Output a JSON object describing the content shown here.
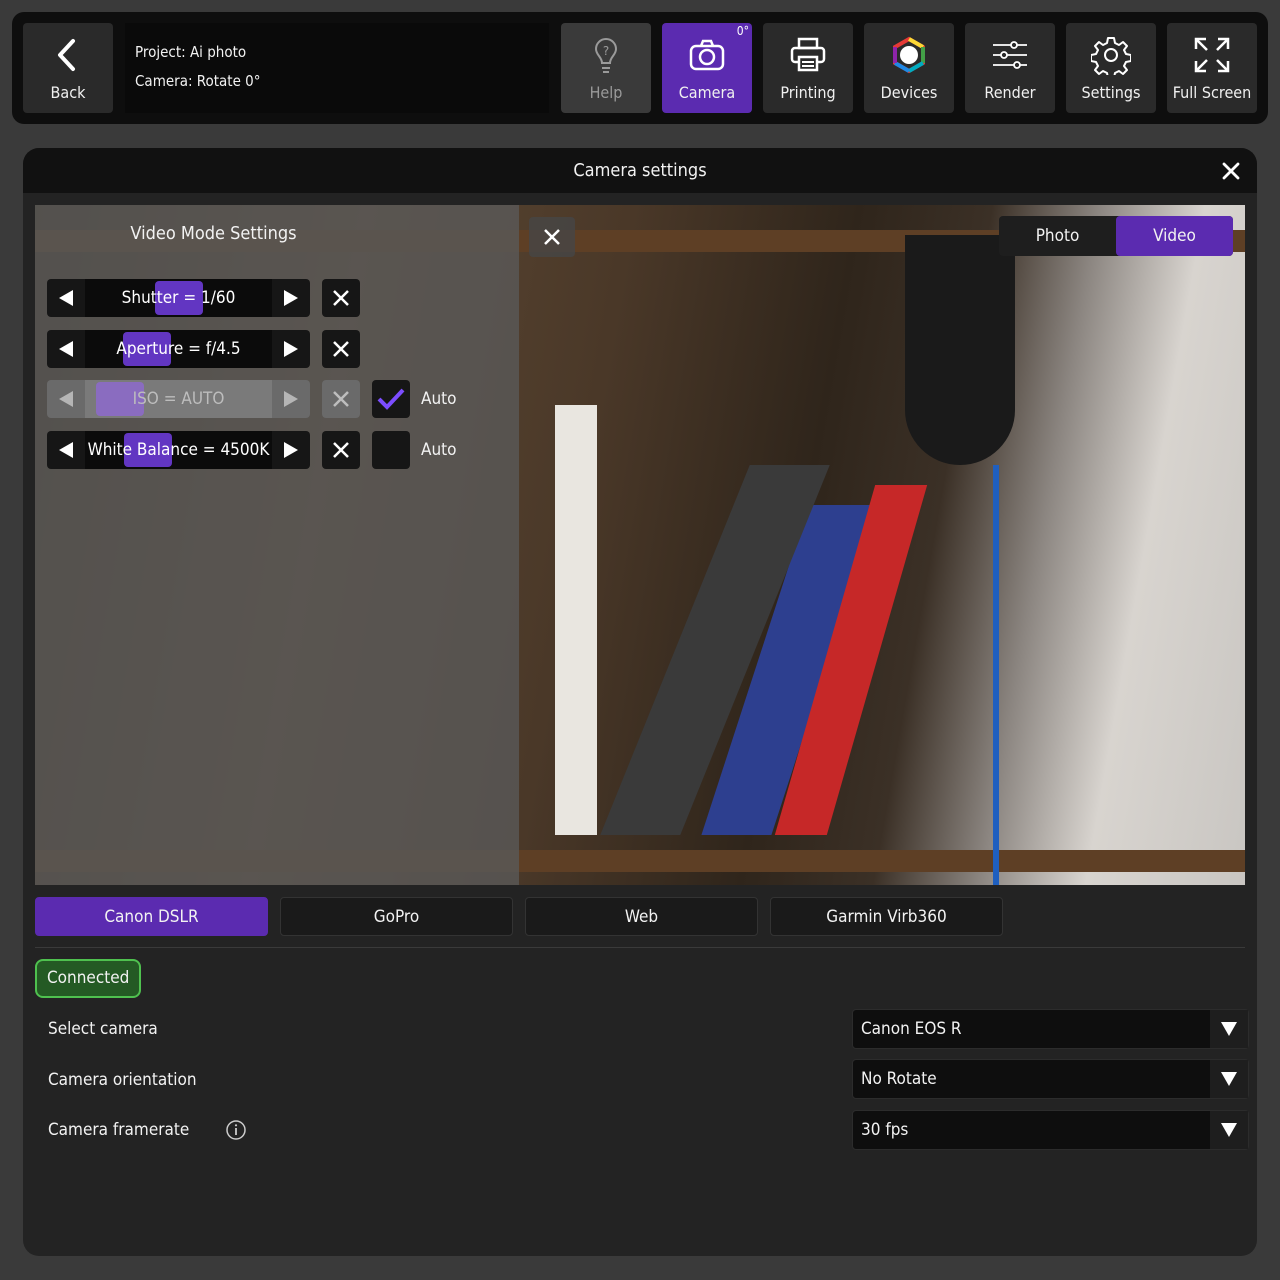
{
  "topbar": {
    "back_label": "Back",
    "project_line": "Project: Ai photo",
    "camera_line": "Camera: Rotate 0°",
    "buttons": [
      {
        "label": "Help",
        "icon": "help-icon",
        "state": "disabled"
      },
      {
        "label": "Camera",
        "icon": "camera-icon",
        "state": "active",
        "badge": "0°"
      },
      {
        "label": "Printing",
        "icon": "printer-icon",
        "state": "normal"
      },
      {
        "label": "Devices",
        "icon": "devices-ring-icon",
        "state": "normal"
      },
      {
        "label": "Render",
        "icon": "sliders-icon",
        "state": "normal"
      },
      {
        "label": "Settings",
        "icon": "gear-icon",
        "state": "normal"
      },
      {
        "label": "Full Screen",
        "icon": "fullscreen-icon",
        "state": "normal"
      }
    ]
  },
  "panel": {
    "title": "Camera settings",
    "overlay_title": "Video Mode Settings",
    "mode_toggle": {
      "photo": "Photo",
      "video": "Video",
      "selected": "Video"
    },
    "controls": [
      {
        "label": "Shutter = 1/60",
        "enabled": true,
        "thumb": 0.5
      },
      {
        "label": "Aperture = f/4.5",
        "enabled": true,
        "thumb": 0.27
      },
      {
        "label": "ISO = AUTO",
        "enabled": false,
        "thumb": 0.08,
        "auto_label": "Auto",
        "auto_checked": true
      },
      {
        "label": "White Balance = 4500K",
        "enabled": true,
        "thumb": 0.28,
        "auto_label": "Auto",
        "auto_checked": false
      }
    ],
    "camera_tabs": [
      "Canon DSLR",
      "GoPro",
      "Web",
      "Garmin Virb360"
    ],
    "camera_tab_selected": "Canon DSLR",
    "status": "Connected",
    "settings": [
      {
        "label": "Select camera",
        "value": "Canon EOS R"
      },
      {
        "label": "Camera orientation",
        "value": "No Rotate"
      },
      {
        "label": "Camera framerate",
        "value": "30 fps",
        "info": true
      }
    ]
  },
  "colors": {
    "accent": "#5b2bb0",
    "connected_border": "#4fc14f",
    "background": "#3a3a3a"
  }
}
